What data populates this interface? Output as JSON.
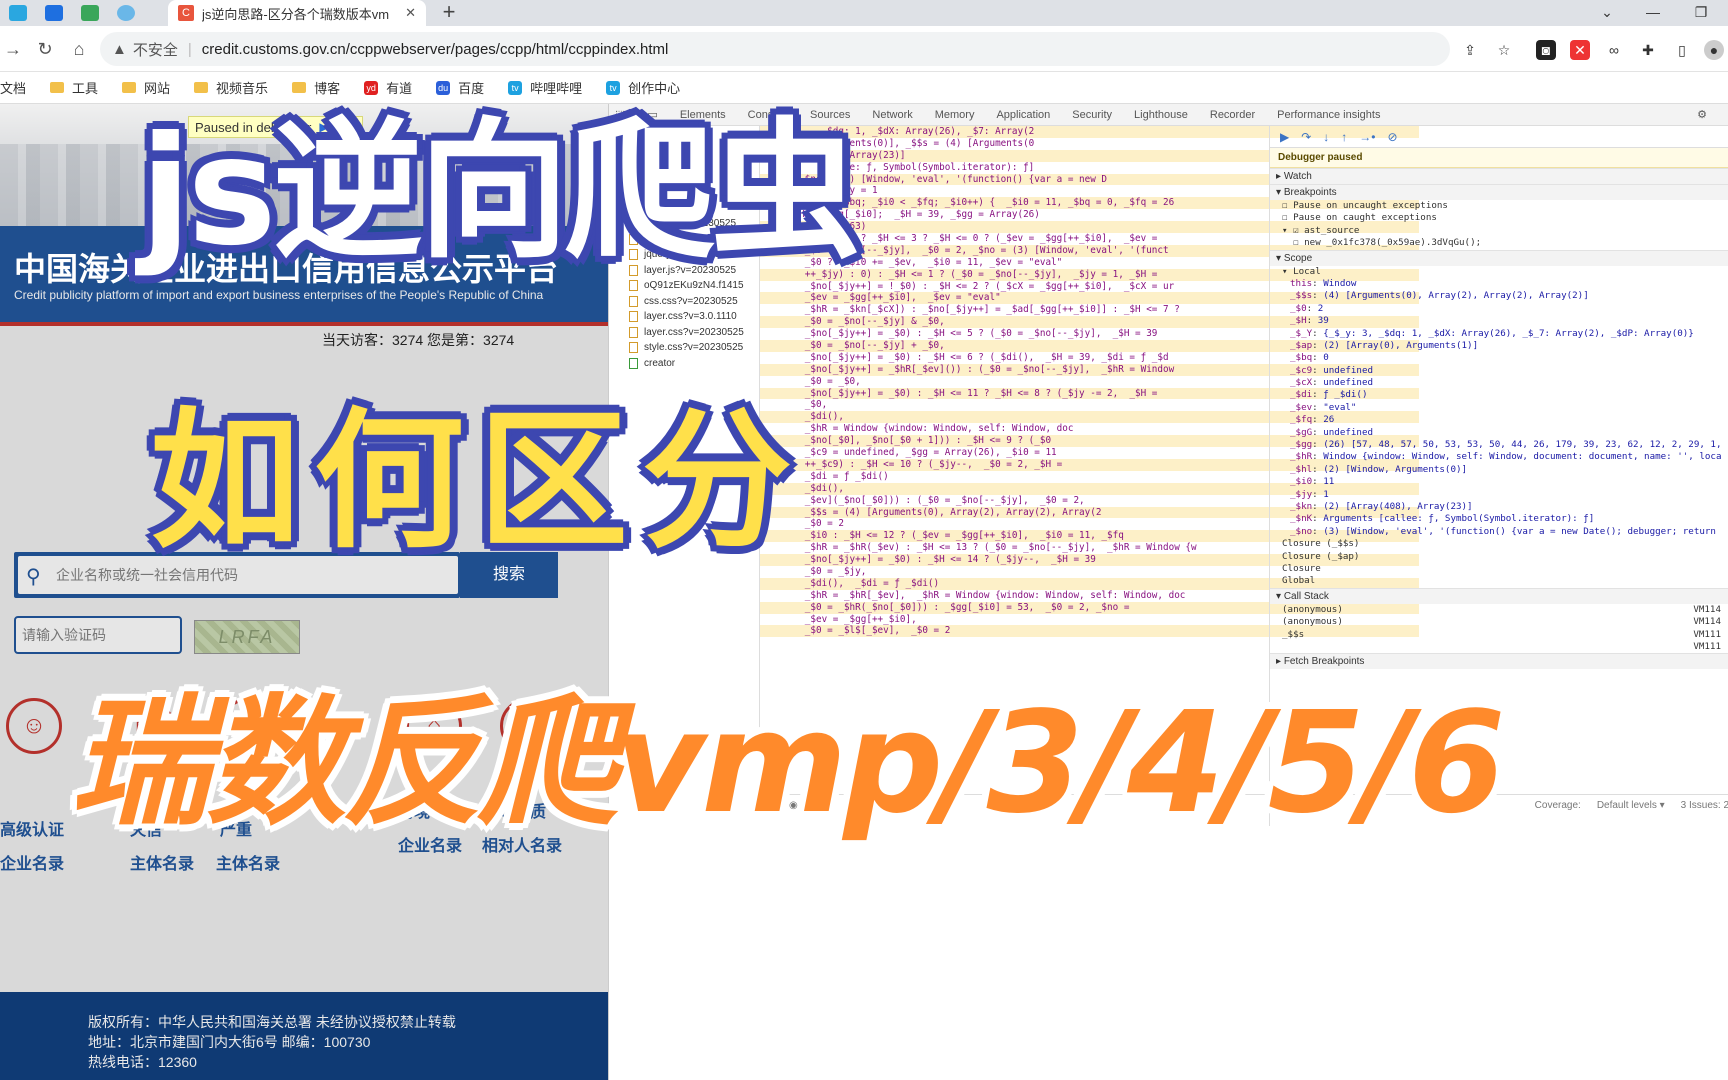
{
  "browser": {
    "active_tab_title": "js逆向思路-区分各个瑞数版本vm",
    "url_security": "不安全",
    "url": "credit.customs.gov.cn/ccppwebserver/pages/ccpp/html/ccppindex.html",
    "new_tab": "+",
    "bookmarks": [
      "文档",
      "工具",
      "网站",
      "视频音乐",
      "博客",
      "有道",
      "百度",
      "哔哩哔哩",
      "创作中心"
    ]
  },
  "site": {
    "paused_badge": "Paused in debugger",
    "cn_title": "中国海关企业进出口信用信息公示平台",
    "en_title": "Credit publicity platform of import and export business enterprises of the People's Republic of China",
    "visitors": "当天访客：3274   您是第：3274",
    "search_placeholder": "企业名称或统一社会信用代码",
    "search_button": "搜索",
    "captcha_placeholder": "请输入验证码",
    "captcha_text": "LRFA",
    "services": [
      {
        "line1": "高级认证",
        "line2": "企业名录"
      },
      {
        "line1": "失信",
        "line2": "主体名录"
      },
      {
        "line1": "严重",
        "line2": "主体名录"
      },
      {
        "line1": "跨境电商",
        "line2": "企业名录"
      },
      {
        "line1": "认定资质",
        "line2": "相对人名录"
      }
    ],
    "footer": [
      "版权所有：中华人民共和国海关总署   未经协议授权禁止转载",
      "地址：北京市建国门内大街6号 邮编：100730",
      "热线电话：12360"
    ]
  },
  "devtools": {
    "tabs": [
      "Elements",
      "Console",
      "Sources",
      "Network",
      "Memory",
      "Application",
      "Security",
      "Lighthouse",
      "Recorder",
      "Performance insights"
    ],
    "files": [
      "ccpp.js?v=20230525",
      "common.js?v=202305",
      "jquery.min.js?v=2.1.4",
      "layer.js?v=20230525",
      "oQ91zEKu9zN4.f1415",
      "css.css?v=20230525",
      "layer.css?v=3.0.1110",
      "layer.css?v=20230525",
      "style.css?v=20230525",
      "creator"
    ],
    "code": [
      "           _$dq: 1, _$dX: Array(26), _$7: Array(2",
      "           Arguments(0)], _$$s = (4) [Arguments(0",
      "           (0), Array(23)]",
      "           callee: ƒ, Symbol(Symbol.iterator): ƒ]",
      "       _$no = (3) [Window, 'eval', '(function() {var a = new D",
      "  _$jy = 0;  _$jy = 1",
      "  for (_$i0 = _$bq; _$i0 < _$fq; _$i0++) {  _$i0 = 11, _$bq = 0, _$fq = 26",
      "     _$H = _$gg[_$i0];  _$H = 39, _$gg = Array(26)",
      "     if (_$H <= 63)",
      "        _$H <= 15 ? _$H <= 3 ? _$H <= 0 ? (_$ev = _$gg[++_$i0],  _$ev = ",
      "        _$0 = _$no[--_$jy],  _$0 = 2, _$no = (3) [Window, 'eval', '(funct",
      "        _$0 ? (_$i0 += _$ev,  _$i0 = 11, _$ev = \"eval\"",
      "        ++_$jy) : 0) : _$H <= 1 ? (_$0 = _$no[--_$jy],  _$jy = 1, _$H = ",
      "        _$no[_$jy++] = !_$0) : _$H <= 2 ? (_$cX = _$gg[++_$i0],  _$cX = ur",
      "        _$ev = _$gg[++_$i0],  _$ev = \"eval\"",
      "        _$hR = _$kn[_$cX]) : _$no[_$jy++] = _$ad[_$gg[++_$i0]] : _$H <= 7 ?",
      "        _$0 = _$no[--_$jy] & _$0,",
      "        _$no[_$jy++] = _$0) : _$H <= 5 ? (_$0 = _$no[--_$jy],  _$H = 39",
      "        _$0 = _$no[--_$jy] + _$0,",
      "        _$no[_$jy++] = _$0) : _$H <= 6 ? (_$di(),  _$H = 39, _$di = ƒ _$d",
      "        _$no[_$jy++] = _$hR[_$ev]()) : (_$0 = _$no[--_$jy],  _$hR = Window",
      "        _$0 = _$0,",
      "        _$no[_$jy++] = _$0) : _$H <= 11 ? _$H <= 8 ? (_$jy -= 2,  _$H = ",
      "        _$0,",
      "        _$di(),",
      "        _$hR = Window {window: Window, self: Window, doc",
      "        _$no[_$0], _$no[_$0 + 1])) : _$H <= 9 ? (_$0",
      "        _$c9 = undefined, _$gg = Array(26), _$i0 = 11",
      "        ++_$c9) : _$H <= 10 ? (_$jy--,  _$0 = 2, _$H = ",
      "        _$di = ƒ _$di()",
      "        _$di(),",
      "        _$ev](_$no[_$0])) : (_$0 = _$no[--_$jy],  _$0 = 2, ",
      "        _$$s = (4) [Arguments(0), Array(2), Array(2), Array(2",
      "        _$0 = 2",
      "        _$i0 : _$H <= 12 ? (_$ev = _$gg[++_$i0],  _$i0 = 11, _$fq",
      "        _$hR = _$hR(_$ev) : _$H <= 13 ? (_$0 = _$no[--_$jy],  _$hR = Window {w",
      "        _$no[_$jy++] = _$0) : _$H <= 14 ? (_$jy--,  _$H = 39",
      "        _$0 = _$jy,",
      "        _$di(),  _$di = ƒ _$di()",
      "        _$hR = _$hR[_$ev],  _$hR = Window {window: Window, self: Window, doc",
      "        _$0 = _$hR(_$no[_$0])) : _$gg[_$i0] = 53,  _$0 = 2, _$no = ",
      "        _$ev = _$gg[++_$i0],",
      "        _$0 = _$l$[_$ev],  _$0 = 2"
    ],
    "debugger": {
      "paused": "Debugger paused",
      "watch": "Watch",
      "breakpoints": "Breakpoints",
      "pause_uncaught": "Pause on uncaught exceptions",
      "pause_caught": "Pause on caught exceptions",
      "ast_source": "ast_source",
      "ast_code": "new _0x1fc378(_0x59ae).3dVqGu();",
      "scope": "Scope",
      "local": "Local",
      "vars": [
        [
          "this",
          "Window"
        ],
        [
          "_$$s",
          "(4) [Arguments(0), Array(2), Array(2), Array(2)]"
        ],
        [
          "_$0",
          "2"
        ],
        [
          "_$H",
          "39"
        ],
        [
          "_$_Y",
          "{_$_y: 3, _$dq: 1, _$dX: Array(26), _$_7: Array(2), _$dP: Array(0)}"
        ],
        [
          "_$ap",
          "(2) [Array(0), Arguments(1)]"
        ],
        [
          "_$bq",
          "0"
        ],
        [
          "_$c9",
          "undefined"
        ],
        [
          "_$cX",
          "undefined"
        ],
        [
          "_$di",
          "ƒ _$di()"
        ],
        [
          "_$ev",
          "\"eval\""
        ],
        [
          "_$fq",
          "26"
        ],
        [
          "_$gG",
          "undefined"
        ],
        [
          "_$gg",
          "(26) [57, 48, 57, 50, 53, 53, 50, 44, 26, 179, 39, 23, 62, 12, 2, 29, 1,"
        ],
        [
          "_$hR",
          "Window {window: Window, self: Window, document: document, name: '', loca"
        ],
        [
          "_$hl",
          "(2) [Window, Arguments(0)]"
        ],
        [
          "_$i0",
          "11"
        ],
        [
          "_$jy",
          "1"
        ],
        [
          "_$kn",
          "(2) [Array(408), Array(23)]"
        ],
        [
          "_$nK",
          "Arguments [callee: ƒ, Symbol(Symbol.iterator): ƒ]"
        ],
        [
          "_$no",
          "(3) [Window, 'eval', '(function() {var a = new Date(); debugger; return"
        ]
      ],
      "closures": [
        "Closure (_$$s)",
        "Closure (_$ap)",
        "Closure",
        "Global"
      ],
      "call_stack": "Call Stack",
      "stack": [
        [
          "(anonymous)",
          "VM114"
        ],
        [
          "(anonymous)",
          "VM114"
        ],
        [
          "_$$s",
          "VM111"
        ],
        [
          "",
          "VM111"
        ]
      ],
      "fetch_bp": "Fetch Breakpoints"
    },
    "console": {
      "filter": "Filter",
      "levels": "Default levels ▾",
      "issues": "3 Issues: 2",
      "coverage": "Coverage:"
    }
  },
  "overlay": {
    "line1": "js逆向爬虫",
    "line2": "如何区分",
    "line3": "瑞数反爬vmp/3/4/5/6"
  }
}
